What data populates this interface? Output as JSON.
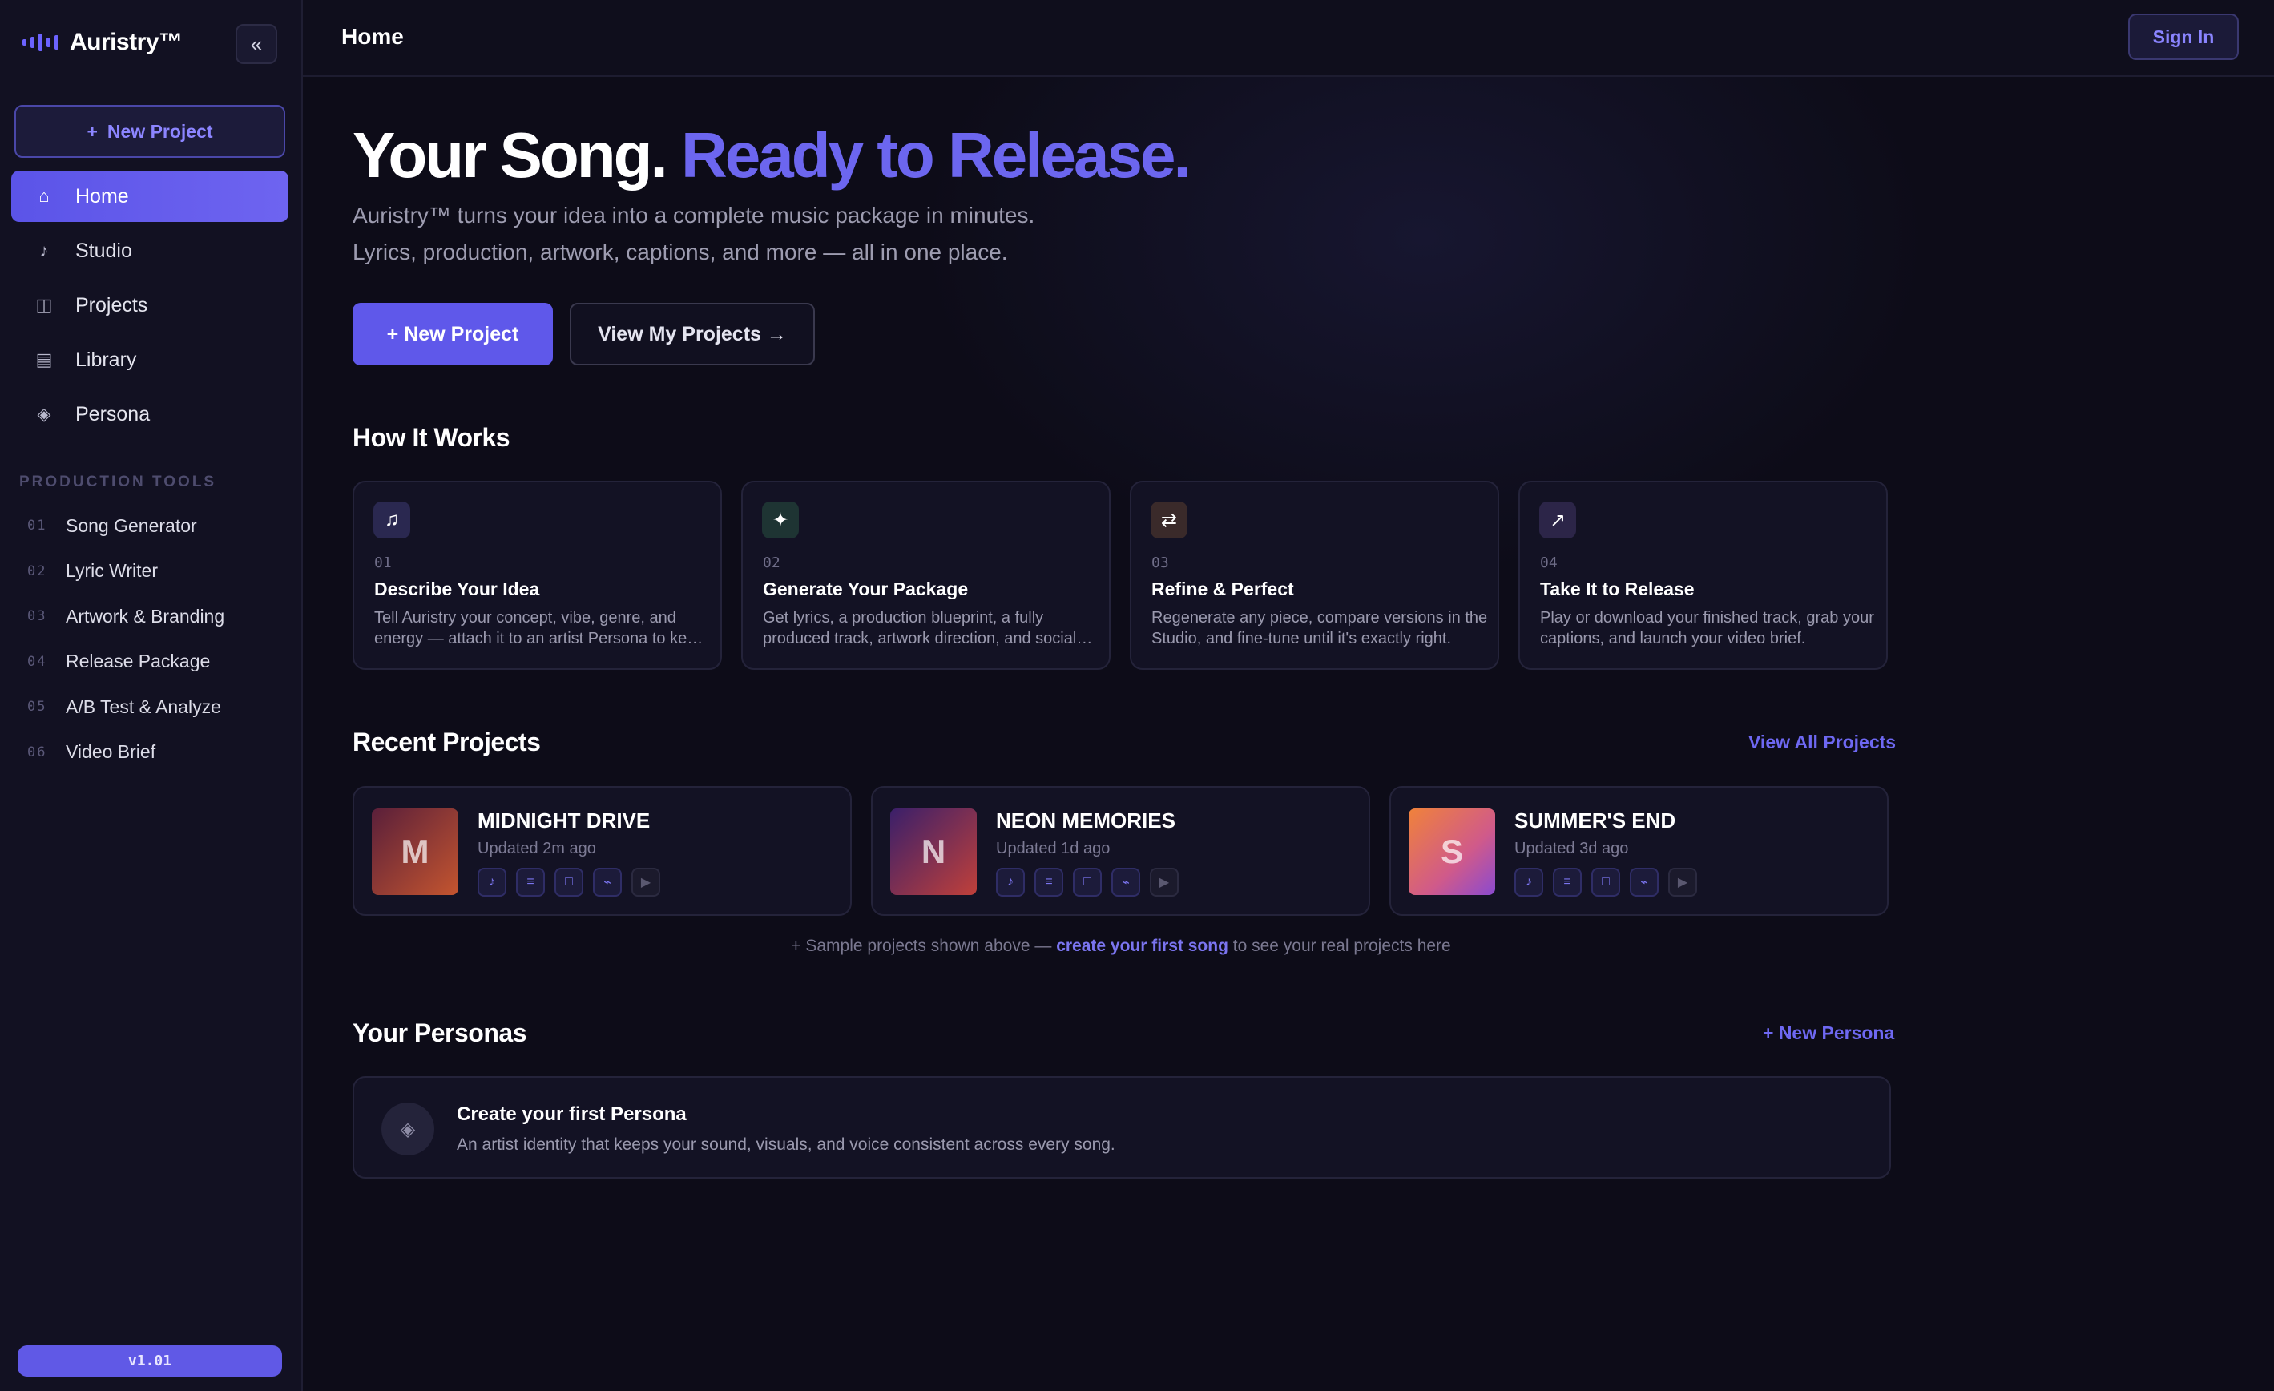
{
  "app": {
    "brand": "Auristry™",
    "collapse_icon": "«",
    "version": "v1.01"
  },
  "sidebar": {
    "new_project_label": "New Project",
    "nav": [
      {
        "label": "Home",
        "icon": "⌂",
        "active": true
      },
      {
        "label": "Studio",
        "icon": "♪"
      },
      {
        "label": "Projects",
        "icon": "◫"
      },
      {
        "label": "Library",
        "icon": "▤"
      },
      {
        "label": "Persona",
        "icon": "◈"
      }
    ],
    "section_title": "PRODUCTION TOOLS",
    "tools": [
      {
        "num": "01",
        "label": "Song Generator"
      },
      {
        "num": "02",
        "label": "Lyric Writer"
      },
      {
        "num": "03",
        "label": "Artwork & Branding"
      },
      {
        "num": "04",
        "label": "Release Package"
      },
      {
        "num": "05",
        "label": "A/B Test & Analyze"
      },
      {
        "num": "06",
        "label": "Video Brief"
      }
    ]
  },
  "header": {
    "title": "Home",
    "sign_in": "Sign In"
  },
  "hero": {
    "title_a": "Your Song.",
    "title_b": "Ready to Release.",
    "sub_1": "Auristry™ turns your idea into a complete music package in minutes.",
    "sub_2": "Lyrics, production, artwork, captions, and more — all in one place.",
    "primary_btn": "+ New Project",
    "secondary_btn": "View My Projects →"
  },
  "how": {
    "title": "How It Works",
    "steps": [
      {
        "num": "01",
        "icon": "♫",
        "title": "Describe Your Idea",
        "desc": "Tell Auristry your concept, vibe, genre, and energy — attach it to an artist Persona to keep every song on-brand.",
        "color": "#2a2850"
      },
      {
        "num": "02",
        "icon": "✦",
        "title": "Generate Your Package",
        "desc": "Get lyrics, a production blueprint, a fully produced track, artwork direction, and social captions in one go.",
        "color": "#1e3433"
      },
      {
        "num": "03",
        "icon": "⇄",
        "title": "Refine & Perfect",
        "desc": "Regenerate any piece, compare versions in the Studio, and fine-tune until it's exactly right.",
        "color": "#3a2a2a"
      },
      {
        "num": "04",
        "icon": "↗",
        "title": "Take It to Release",
        "desc": "Play or download your finished track, grab your captions, and launch your video brief.",
        "color": "#2c2548"
      }
    ]
  },
  "recent": {
    "title": "Recent Projects",
    "view_all": "View All Projects",
    "projects": [
      {
        "initial": "M",
        "title": "MIDNIGHT DRIVE",
        "updated": "Updated 2m ago",
        "gradient": "linear-gradient(135deg,#5a1f3a 0%,#c4552f 100%)"
      },
      {
        "initial": "N",
        "title": "NEON MEMORIES",
        "updated": "Updated 1d ago",
        "gradient": "linear-gradient(135deg,#3a1f6a 0%,#c0403a 100%)"
      },
      {
        "initial": "S",
        "title": "SUMMER'S END",
        "updated": "Updated 3d ago",
        "gradient": "linear-gradient(135deg,#f0823a 0%,#d05a8a 60%,#8a4ad0 100%)"
      }
    ],
    "chips": [
      "♪",
      "≡",
      "□",
      "⌁",
      "▶"
    ],
    "note_a": "+ Sample projects shown above — ",
    "note_link": "create your first song",
    "note_b": " to see your real projects here"
  },
  "personas": {
    "title": "Your Personas",
    "new_label": "+ New Persona",
    "empty_icon": "◈",
    "empty_title": "Create your first Persona",
    "empty_desc": "An artist identity that keeps your sound, visuals, and voice consistent across every song."
  }
}
